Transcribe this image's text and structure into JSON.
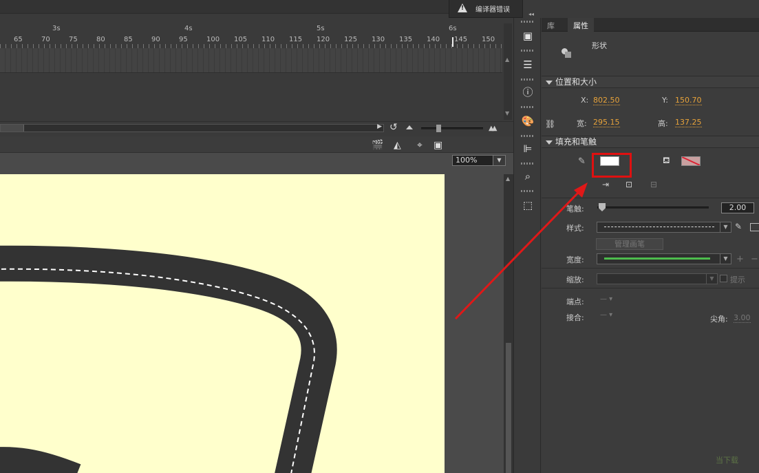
{
  "compiler": {
    "label": "编译器错误"
  },
  "timeline": {
    "seconds": [
      "3s",
      "4s",
      "5s",
      "6s"
    ],
    "frames": [
      "65",
      "70",
      "75",
      "80",
      "85",
      "90",
      "95",
      "100",
      "105",
      "110",
      "115",
      "120",
      "125",
      "130",
      "135",
      "140",
      "145",
      "150"
    ]
  },
  "stage": {
    "zoom": "100%"
  },
  "panel": {
    "tabs": {
      "library": "库",
      "properties": "属性"
    },
    "object_type": "形状",
    "position_section": "位置和大小",
    "x_label": "X:",
    "x_value": "802.50",
    "y_label": "Y:",
    "y_value": "150.70",
    "width_label": "宽:",
    "width_value": "295.15",
    "height_label": "高:",
    "height_value": "137.25",
    "fill_section": "填充和笔触",
    "stroke_label": "笔触:",
    "stroke_value": "2.00",
    "style_label": "样式:",
    "manage_brush": "管理画笔",
    "width_profile_label": "宽度:",
    "scale_label": "缩放:",
    "hint_label": "提示",
    "cap_label": "端点:",
    "join_label": "接合:",
    "miter_label": "尖角:",
    "miter_value": "3.00"
  },
  "watermark": "当下载"
}
